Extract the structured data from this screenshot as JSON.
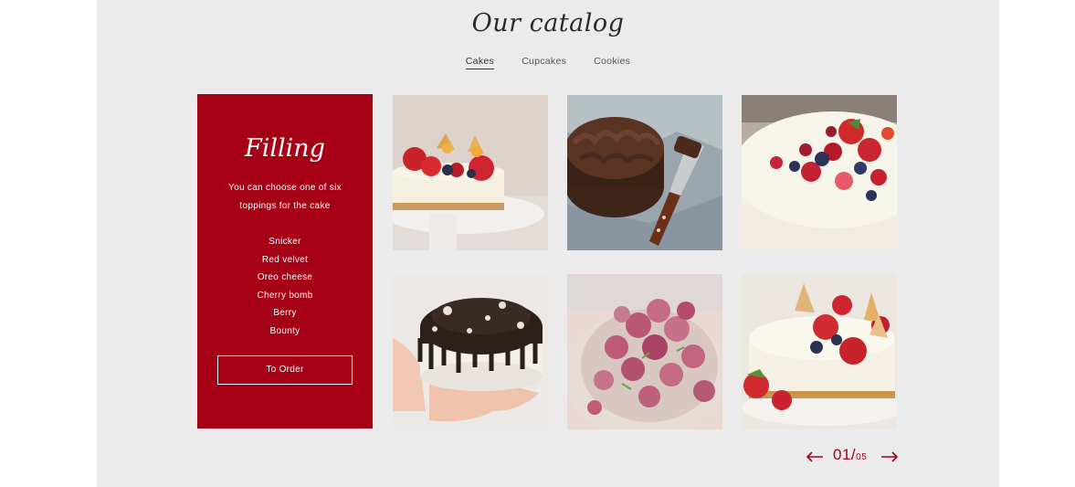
{
  "header": {
    "title": "Our catalog"
  },
  "tabs": [
    {
      "label": "Cakes",
      "active": true
    },
    {
      "label": "Cupcakes",
      "active": false
    },
    {
      "label": "Cookies",
      "active": false
    }
  ],
  "filling": {
    "title": "Filling",
    "description": "You can choose one of six toppings for the cake",
    "toppings": [
      "Snicker",
      "Red velvet",
      "Oreo cheese",
      "Cherry bomb",
      "Berry",
      "Bounty"
    ],
    "order_label": "To Order"
  },
  "gallery": {
    "photos": [
      {
        "icon": "cheesecake-strawberry-image"
      },
      {
        "icon": "chocolate-cake-image"
      },
      {
        "icon": "berry-cheesecake-image"
      },
      {
        "icon": "oreo-drip-cake-image"
      },
      {
        "icon": "raspberry-pavlova-image"
      },
      {
        "icon": "strawberry-physalis-cake-image"
      }
    ]
  },
  "pagination": {
    "current": "01",
    "separator": "/",
    "total": "05"
  },
  "colors": {
    "accent": "#a50016",
    "background": "#ebebeb"
  }
}
